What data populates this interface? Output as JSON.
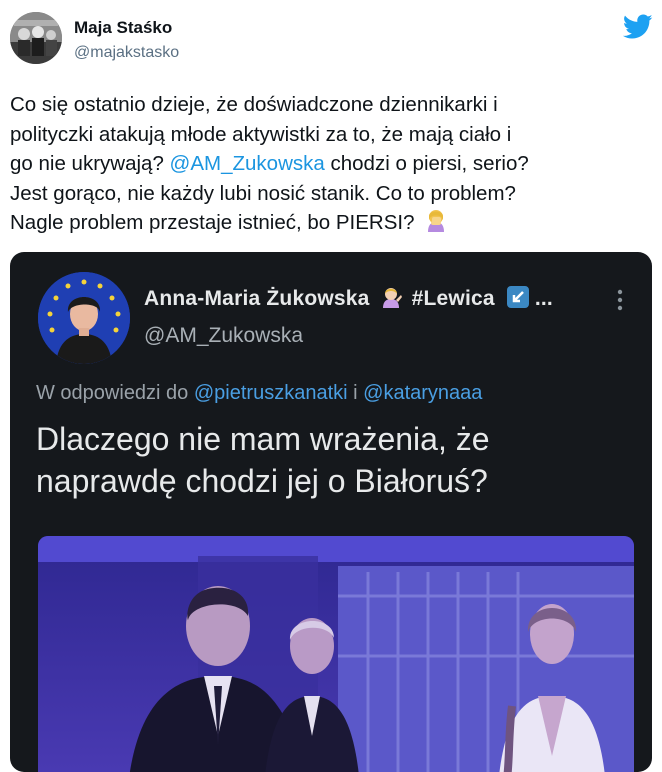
{
  "tweet": {
    "author_name": "Maja Staśko",
    "author_handle": "@majakstasko",
    "text_before_mention": "Co się ostatnio dzieje, że doświadczone dziennikarki i\npolityczki atakują młode aktywistki za to, że mają ciało i\ngo nie ukrywają? ",
    "mention": "@AM_Zukowska",
    "text_after_mention": " chodzi o piersi, serio?\nJest gorąco, nie każdy lubi nosić stanik. Co to problem?\nNagle problem przestaje istnieć, bo PIERSI? ",
    "emoji": "woman-facepalming-emoji"
  },
  "embedded_screenshot": {
    "author_name": "Anna-Maria Żukowska",
    "author_suffix": "#Lewica",
    "author_trailing": "...",
    "author_emoji": "woman-tipping-hand-emoji",
    "author_handle": "@AM_Zukowska",
    "reply_prefix": "W odpowiedzi do",
    "reply_mention_1": "@pietruszkanatki",
    "reply_join": "i",
    "reply_mention_2": "@katarynaaa",
    "text": "Dlaczego nie mam wrażenia, że naprawdę chodzi jej o Białoruś?"
  },
  "colors": {
    "mention": "#1b95e0",
    "twitter_blue": "#1da1f2",
    "embed_bg": "#15181c",
    "photo_tint": "#3b2c9c"
  }
}
